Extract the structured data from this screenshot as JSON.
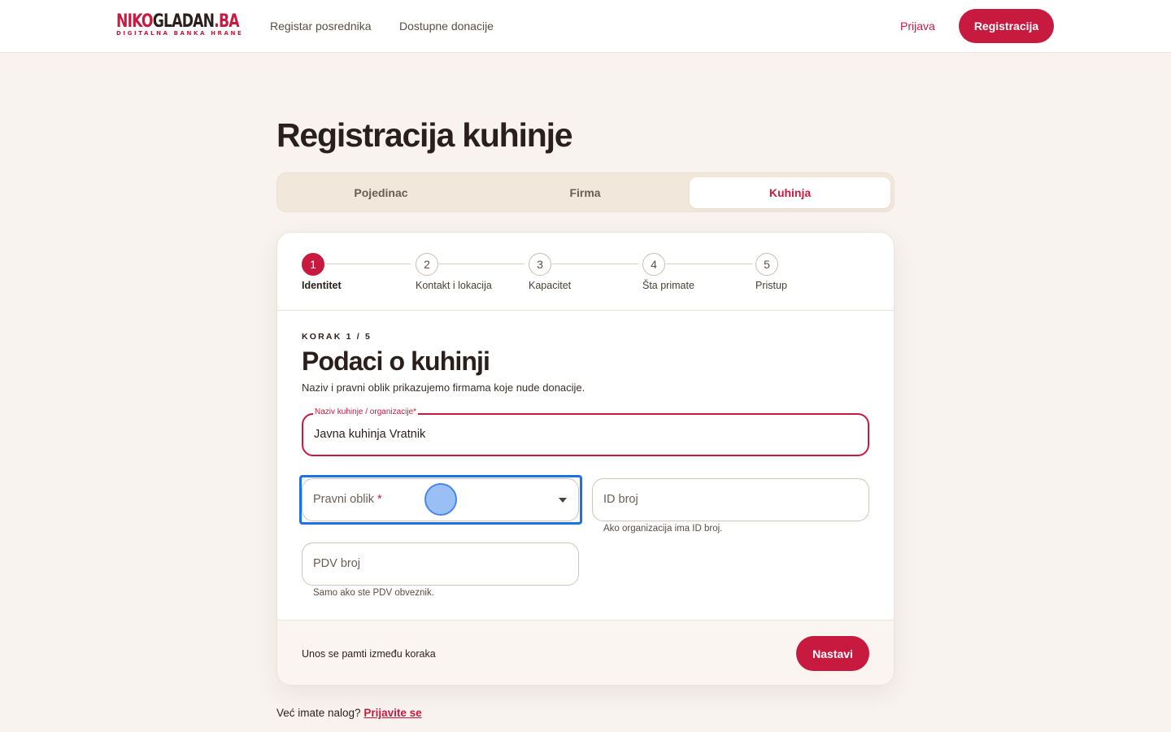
{
  "header": {
    "logo": {
      "niko": "NIKO",
      "gladan": "GLADAN",
      "ba": ".BA",
      "subtitle": "DIGITALNA BANKA HRANE"
    },
    "nav": [
      {
        "label": "Registar posrednika"
      },
      {
        "label": "Dostupne donacije"
      }
    ],
    "login_label": "Prijava",
    "register_label": "Registracija"
  },
  "page": {
    "title": "Registracija kuhinje"
  },
  "tabs": [
    {
      "label": "Pojedinac",
      "active": false
    },
    {
      "label": "Firma",
      "active": false
    },
    {
      "label": "Kuhinja",
      "active": true
    }
  ],
  "stepper": {
    "steps": [
      {
        "number": "1",
        "label": "Identitet",
        "active": true
      },
      {
        "number": "2",
        "label": "Kontakt i lokacija",
        "active": false
      },
      {
        "number": "3",
        "label": "Kapacitet",
        "active": false
      },
      {
        "number": "4",
        "label": "Šta primate",
        "active": false
      },
      {
        "number": "5",
        "label": "Pristup",
        "active": false
      }
    ]
  },
  "form": {
    "step_indicator": "KORAK 1 / 5",
    "title": "Podaci o kuhinji",
    "description": "Naziv i pravni oblik prikazujemo firmama koje nude donacije.",
    "name_field": {
      "label": "Naziv kuhinje / organizacije",
      "required_mark": "*",
      "value": "Javna kuhinja Vratnik"
    },
    "legal_form_field": {
      "placeholder": "Pravni oblik",
      "required_mark": "*"
    },
    "id_field": {
      "placeholder": "ID broj",
      "helper": "Ako organizacija ima ID broj."
    },
    "vat_field": {
      "placeholder": "PDV broj",
      "helper": "Samo ako ste PDV obveznik."
    }
  },
  "footer": {
    "note": "Unos se pamti između koraka",
    "continue_label": "Nastavi"
  },
  "login_prompt": {
    "text": "Već imate nalog?",
    "link": "Prijavite se"
  },
  "colors": {
    "accent": "#c8193f",
    "background": "#f8f3ee",
    "focus": "#1a73e8"
  }
}
